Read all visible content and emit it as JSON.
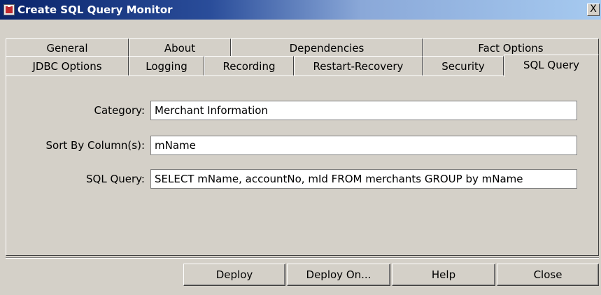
{
  "window": {
    "title": "Create SQL Query Monitor",
    "close_glyph": "X"
  },
  "tabs": {
    "row1": [
      "General",
      "About",
      "Dependencies",
      "Fact Options"
    ],
    "row2": [
      "JDBC Options",
      "Logging",
      "Recording",
      "Restart-Recovery",
      "Security",
      "SQL Query"
    ],
    "active": "SQL Query"
  },
  "form": {
    "category": {
      "label": "Category:",
      "value": "Merchant Information"
    },
    "sort_by": {
      "label": "Sort By Column(s):",
      "value": "mName"
    },
    "sql_query": {
      "label": "SQL Query:",
      "value": "SELECT mName, accountNo, mId FROM merchants GROUP by mName"
    }
  },
  "buttons": {
    "deploy": "Deploy",
    "deploy_on": "Deploy On...",
    "help": "Help",
    "close": "Close"
  }
}
